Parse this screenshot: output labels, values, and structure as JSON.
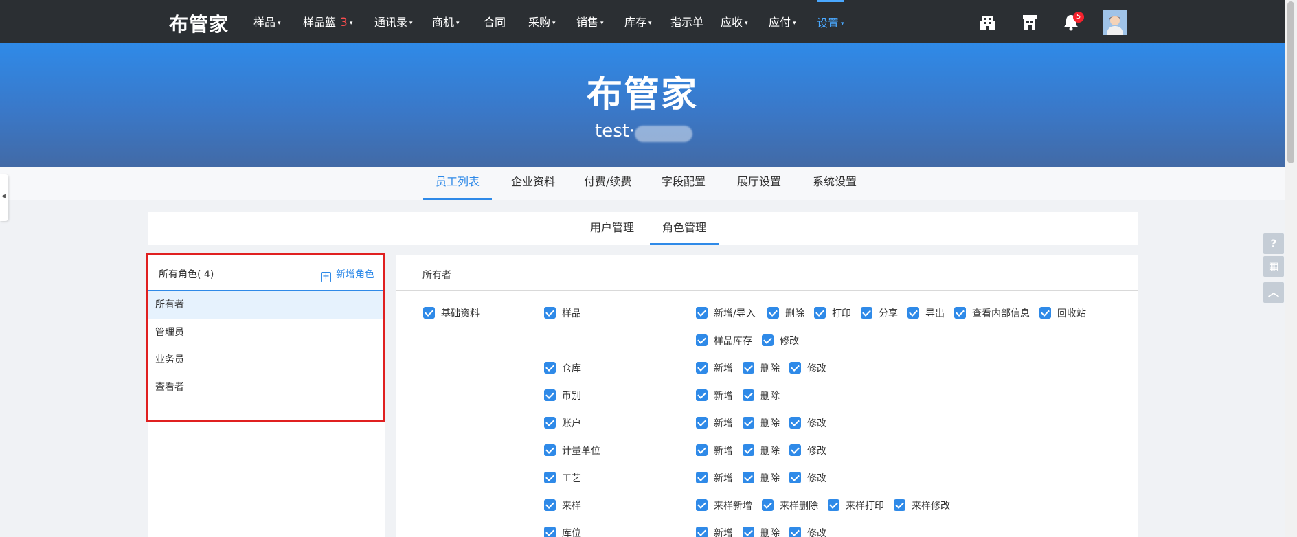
{
  "app": {
    "logo": "布管家"
  },
  "nav": {
    "items": [
      {
        "label": "样品",
        "caret": "▾"
      },
      {
        "label": "样品篮",
        "badge": "3",
        "caret": "▾"
      },
      {
        "label": "通讯录",
        "caret": "▾"
      },
      {
        "label": "商机",
        "caret": "▾"
      },
      {
        "label": "合同",
        "caret": ""
      },
      {
        "label": "采购",
        "caret": "▾"
      },
      {
        "label": "销售",
        "caret": "▾"
      },
      {
        "label": "库存",
        "caret": "▾"
      },
      {
        "label": "指示单",
        "caret": ""
      },
      {
        "label": "应收",
        "caret": "▾"
      },
      {
        "label": "应付",
        "caret": "▾"
      },
      {
        "label": "设置",
        "caret": "▾",
        "active": true
      }
    ],
    "notification_count": "5",
    "icons": [
      "building-icon",
      "store-icon",
      "bell-icon"
    ]
  },
  "banner": {
    "title": "布管家",
    "subtitle": "test·"
  },
  "main_tabs": [
    "员工列表",
    "企业资料",
    "付费/续费",
    "字段配置",
    "展厅设置",
    "系统设置"
  ],
  "main_tab_active": 0,
  "sub_tabs": [
    "用户管理",
    "角色管理"
  ],
  "sub_tab_active": 1,
  "roles": {
    "header": "所有角色( 4)",
    "add_label": "新增角色",
    "add_icon": "plus-square-icon",
    "items": [
      "所有者",
      "管理员",
      "业务员",
      "查看者"
    ],
    "selected": 0
  },
  "permissions": {
    "title": "所有者",
    "module": "基础资料",
    "rows": [
      {
        "name": "样品",
        "actions": [
          "新增/导入",
          "删除",
          "打印",
          "分享",
          "导出",
          "查看内部信息",
          "回收站"
        ]
      },
      {
        "name": "",
        "actions": [
          "样品库存",
          "修改"
        ]
      },
      {
        "name": "仓库",
        "actions": [
          "新增",
          "删除",
          "修改"
        ]
      },
      {
        "name": "币别",
        "actions": [
          "新增",
          "删除"
        ]
      },
      {
        "name": "账户",
        "actions": [
          "新增",
          "删除",
          "修改"
        ]
      },
      {
        "name": "计量单位",
        "actions": [
          "新增",
          "删除",
          "修改"
        ]
      },
      {
        "name": "工艺",
        "actions": [
          "新增",
          "删除",
          "修改"
        ]
      },
      {
        "name": "来样",
        "actions": [
          "来样新增",
          "来样删除",
          "来样打印",
          "来样修改"
        ]
      },
      {
        "name": "库位",
        "actions": [
          "新增",
          "删除",
          "修改"
        ]
      }
    ]
  },
  "floating_tools": [
    {
      "icon": "help-icon",
      "glyph": "?"
    },
    {
      "icon": "qrcode-icon",
      "glyph": "▦"
    },
    {
      "icon": "back-to-top-icon",
      "glyph": "︿"
    }
  ],
  "colors": {
    "nav_bg": "#2b2f33",
    "accent": "#2f8ae8",
    "active_nav": "#4aa8ff",
    "highlight_border": "#e02020"
  }
}
